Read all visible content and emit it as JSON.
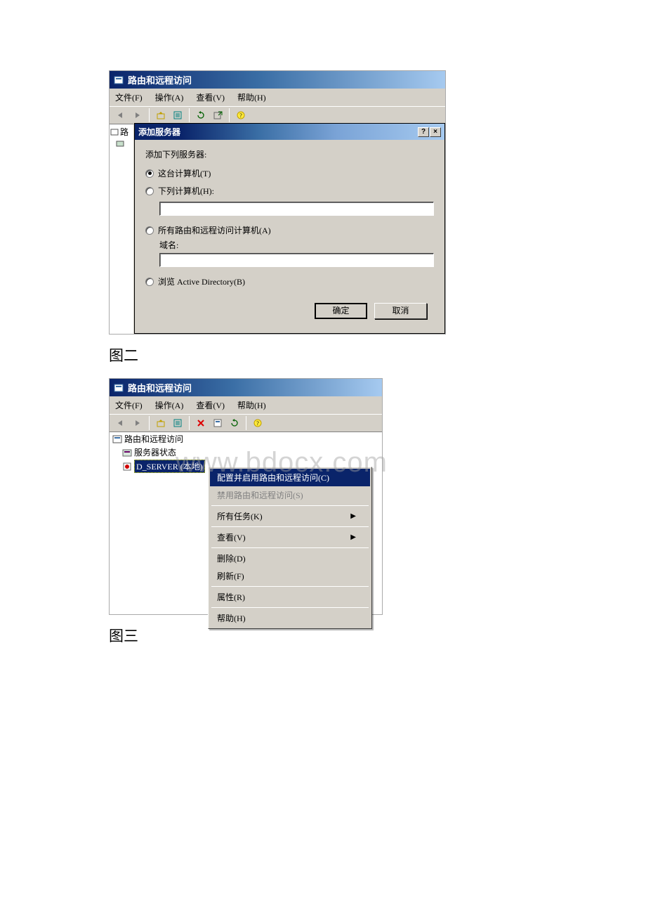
{
  "watermark": "www.bdocx.com",
  "caption2": "图二",
  "caption3": "图三",
  "shot1": {
    "title": "路由和远程访问",
    "menu": {
      "file": "文件(F)",
      "action": "操作(A)",
      "view": "查看(V)",
      "help": "帮助(H)"
    },
    "tree_root_short": "路",
    "dialog": {
      "title": "添加服务器",
      "help_icon": "?",
      "close_icon": "×",
      "prompt": "添加下列服务器:",
      "opt_this": "这台计算机(T)",
      "opt_following": "下列计算机(H):",
      "opt_allrras": "所有路由和远程访问计算机(A)",
      "domain_label": "域名:",
      "opt_browse": "浏览 Active Directory(B)",
      "ok": "确定",
      "cancel": "取消"
    }
  },
  "shot2": {
    "title": "路由和远程访问",
    "menu": {
      "file": "文件(F)",
      "action": "操作(A)",
      "view": "查看(V)",
      "help": "帮助(H)"
    },
    "tree": {
      "root": "路由和远程访问",
      "status": "服务器状态",
      "server": "D_SERVER (本地)"
    },
    "ctx": {
      "configure": "配置并启用路由和远程访问(C)",
      "disable": "禁用路由和远程访问(S)",
      "alltasks": "所有任务(K)",
      "view": "查看(V)",
      "delete": "删除(D)",
      "refresh": "刷新(F)",
      "properties": "属性(R)",
      "help": "帮助(H)"
    }
  }
}
